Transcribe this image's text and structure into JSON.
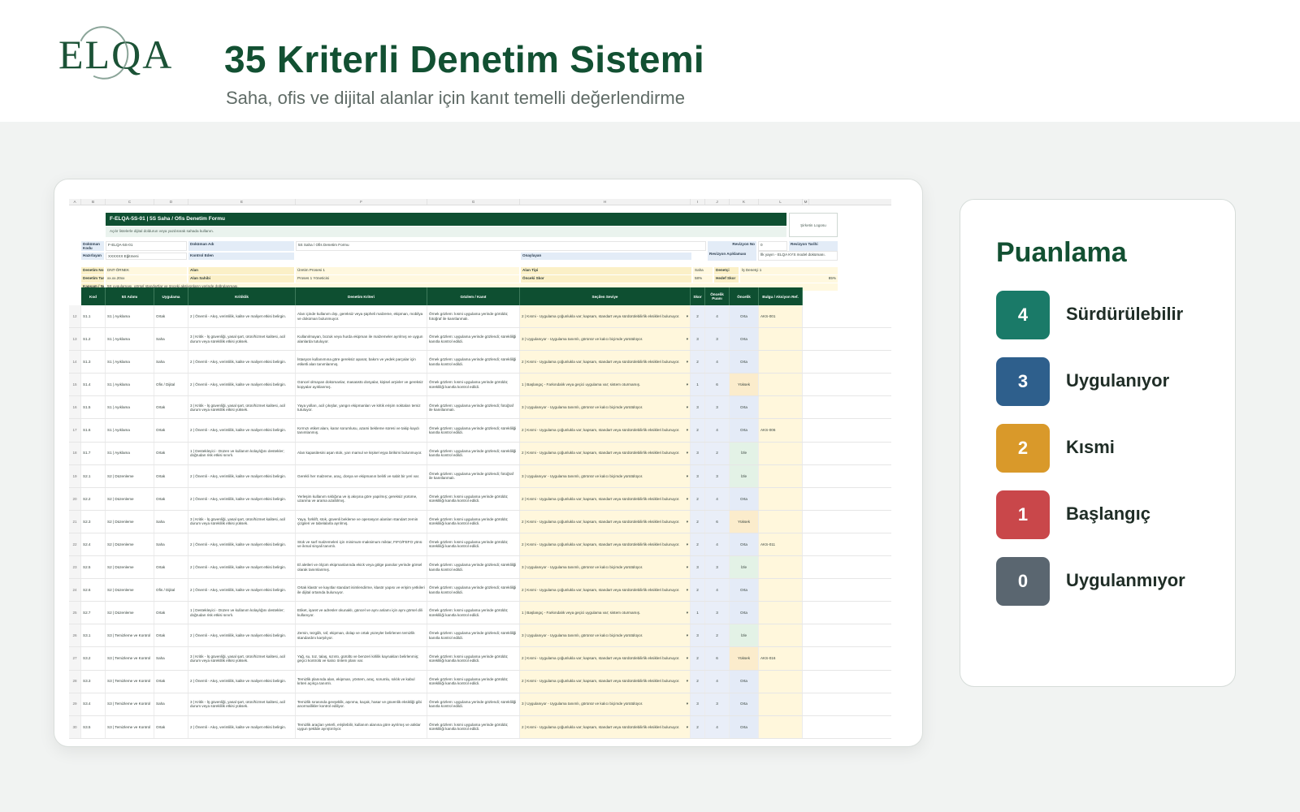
{
  "header": {
    "logo_text": "ELQA",
    "title": "35 Kriterli Denetim Sistemi",
    "subtitle": "Saha, ofis ve dijital alanlar için kanıt temelli değerlendirme"
  },
  "sheet": {
    "column_letters": [
      "A",
      "B",
      "C",
      "D",
      "E",
      "F",
      "G",
      "H",
      "I",
      "J",
      "K",
      "L",
      "M"
    ],
    "form_title": "F-ELQA-5S-01 | 5S Saha / Ofis Denetim Formu",
    "form_subtitle": "Açılır listelerle dijital doldurun veya yazdırarak sahada kullanın.",
    "logo_placeholder": "Şirketin Logosu",
    "meta": {
      "dokuman_kodu_label": "Doküman Kodu",
      "dokuman_kodu": "F-ELQA-5S-01",
      "dokuman_adi_label": "Doküman Adı",
      "dokuman_adi": "5S Saha / Ofis Denetim Formu",
      "revizyon_no_label": "Revizyon No",
      "revizyon_no": "0",
      "revizyon_tarihi_label": "Revizyon Tarihi",
      "hazirlayan_label": "Hazırlayan",
      "hazirlayan": "XXXXXX Eğitmeni",
      "kontrol_eden_label": "Kontrol Eden",
      "onaylayan_label": "Onaylayan",
      "revizyon_aciklamasi_label": "Revizyon Açıklaması",
      "revizyon_aciklamasi": "İlk yayın - ELQA KYS model dokümanı.",
      "denetim_no_label": "Denetim No",
      "denetim_no": "DNT-ÖRNEK",
      "alan_label": "Alan",
      "alan": "Üretim Prosesi 1",
      "alan_tipi_label": "Alan Tipi",
      "alan_tipi": "Saha",
      "denetci_label": "Denetçi",
      "denetci": "İş Denetçi 1",
      "denetim_tarihi_label": "Denetim Tarihi",
      "denetim_tarihi": "xx.xx.20xx",
      "alan_sahibi_label": "Alan Sahibi",
      "alan_sahibi": "Proses 1 Yöneticisi",
      "onceki_skor_label": "Önceki Skor",
      "onceki_skor": "58%",
      "hedef_skor_label": "Hedef Skor",
      "hedef_skor": "85%",
      "kapsam_label": "Kapsam / Not",
      "kapsam": "5S uygulaması, görsel standartlar ve önceki aksiyonların yerinde doğrulanması."
    },
    "columns": [
      "Kod",
      "5S Adımı",
      "Uygulama",
      "Kritiklik",
      "Denetim Kriteri",
      "Gözlem / Kanıt",
      "Seçilen Seviye",
      "Skor",
      "Öncelik Puanı",
      "Öncelik",
      "Bulgu / Aksiyon Ref."
    ],
    "row_numbers": [
      "12",
      "13",
      "14",
      "15",
      "16",
      "17",
      "18",
      "19",
      "20",
      "21",
      "22",
      "23",
      "24",
      "25",
      "26",
      "27",
      "28",
      "29",
      "30"
    ],
    "rows": [
      {
        "rn": "12",
        "kod": "S1.1",
        "adim": "S1 | Ayıklama",
        "uyg": "Ortak",
        "krit": "2 | Önemli - Akış, verimlilik, kalite ve maliyet etkisi belirgin.",
        "kriter": "Alan içinde kullanım dışı, gereksiz veya şüpheli malzeme, ekipman, mobilya ve doküman bulunmuyor.",
        "gozlem": "Örnek gözlem: kısmi uygulama yerinde görüldü; fotoğraf ile kanıtlanmalı.",
        "secim": "2 | Kısmi - Uygulama çoğunlukla var; kapsam, standart veya sürdürülebilirlik eksikleri bulunuyor.",
        "skor": "2",
        "puan": "4",
        "onc": "Orta",
        "lvl": "orta",
        "ref": "AKS-001"
      },
      {
        "rn": "13",
        "kod": "S1.2",
        "adim": "S1 | Ayıklama",
        "uyg": "Saha",
        "krit": "3 | Kritik - İş güvenliği, yasal şart, ürün/hizmet kalitesi, acil durum veya süreklilik etkisi yüksek.",
        "kriter": "Kullanılmayan, bozuk veya hurda ekipman ile malzemeler ayrılmış ve uygun alanlarda tutuluyor.",
        "gozlem": "Örnek gözlem: uygulama yerinde gözlendi; sürekliliği kanıtla kontrol edildi.",
        "secim": "3 | Uygulanıyor - Uygulama tanımlı, görünür ve kalıcı biçimde yürütülüyor.",
        "skor": "3",
        "puan": "3",
        "onc": "Orta",
        "lvl": "orta",
        "ref": ""
      },
      {
        "rn": "14",
        "kod": "S1.3",
        "adim": "S1 | Ayıklama",
        "uyg": "Saha",
        "krit": "2 | Önemli - Akış, verimlilik, kalite ve maliyet etkisi belirgin.",
        "kriter": "İstasyon kullanımına göre gereksiz aparat, bakım ve yedek parçalar için etiketli alan tanımlanmış.",
        "gozlem": "Örnek gözlem: uygulama yerinde gözlendi; sürekliliği kanıtla kontrol edildi.",
        "secim": "2 | Kısmi - Uygulama çoğunlukla var; kapsam, standart veya sürdürülebilirlik eksikleri bulunuyor.",
        "skor": "2",
        "puan": "4",
        "onc": "Orta",
        "lvl": "orta",
        "ref": ""
      },
      {
        "rn": "15",
        "kod": "S1.4",
        "adim": "S1 | Ayıklama",
        "uyg": "Ofis / Dijital",
        "krit": "2 | Önemli - Akış, verimlilik, kalite ve maliyet etkisi belirgin.",
        "kriter": "Güncel olmayan dokümanlar, masaüstü dosyalar, kişisel arşivler ve gereksiz kopyalar ayıklanmış.",
        "gozlem": "Örnek gözlem: kısmi uygulama yerinde görüldü; sürekliliği kanıtla kontrol edildi.",
        "secim": "1 | Başlangıç - Farkındalık veya geçici uygulama var; sistem oturmamış.",
        "skor": "1",
        "puan": "6",
        "onc": "Yüksek",
        "lvl": "yuksek",
        "ref": ""
      },
      {
        "rn": "16",
        "kod": "S1.5",
        "adim": "S1 | Ayıklama",
        "uyg": "Ortak",
        "krit": "3 | Kritik - İş güvenliği, yasal şart, ürün/hizmet kalitesi, acil durum veya süreklilik etkisi yüksek.",
        "kriter": "Yaya yolları, acil çıkışlar, yangın ekipmanları ve kritik erişim noktaları temiz tutuluyor.",
        "gozlem": "Örnek gözlem: uygulama yerinde gözlendi; fotoğraf ile kanıtlanmalı.",
        "secim": "3 | Uygulanıyor - Uygulama tanımlı, görünür ve kalıcı biçimde yürütülüyor.",
        "skor": "3",
        "puan": "3",
        "onc": "Orta",
        "lvl": "orta",
        "ref": ""
      },
      {
        "rn": "17",
        "kod": "S1.6",
        "adim": "S1 | Ayıklama",
        "uyg": "Ortak",
        "krit": "2 | Önemli - Akış, verimlilik, kalite ve maliyet etkisi belirgin.",
        "kriter": "Kırmızı etiket alanı, karar sorumlusu, azami bekleme süresi ve takip kaydı tanımlanmış.",
        "gozlem": "Örnek gözlem: uygulama yerinde gözlendi; sürekliliği kanıtla kontrol edildi.",
        "secim": "2 | Kısmi - Uygulama çoğunlukla var; kapsam, standart veya sürdürülebilirlik eksikleri bulunuyor.",
        "skor": "2",
        "puan": "4",
        "onc": "Orta",
        "lvl": "orta",
        "ref": "AKS-006"
      },
      {
        "rn": "18",
        "kod": "S1.7",
        "adim": "S1 | Ayıklama",
        "uyg": "Ortak",
        "krit": "1 | Destekleyici - Düzen ve kullanım kolaylığını destekler; doğrudan risk etkisi sınırlı.",
        "kriter": "Alan kapasitesini aşan stok, yarı mamul ve kişisel eşya birikimi bulunmuyor.",
        "gozlem": "Örnek gözlem: uygulama yerinde gözlendi; sürekliliği kanıtla kontrol edildi.",
        "secim": "2 | Kısmi - Uygulama çoğunlukla var; kapsam, standart veya sürdürülebilirlik eksikleri bulunuyor.",
        "skor": "3",
        "puan": "2",
        "onc": "İzle",
        "lvl": "iyi",
        "ref": ""
      },
      {
        "rn": "19",
        "kod": "S2.1",
        "adim": "S2 | Düzenleme",
        "uyg": "Ortak",
        "krit": "2 | Önemli - Akış, verimlilik, kalite ve maliyet etkisi belirgin.",
        "kriter": "Gerekli her malzeme, araç, dosya ve ekipmanın belirli ve sabit bir yeri var.",
        "gozlem": "Örnek gözlem: uygulama yerinde gözlendi; fotoğraf ile kanıtlanmalı.",
        "secim": "3 | Uygulanıyor - Uygulama tanımlı, görünür ve kalıcı biçimde yürütülüyor.",
        "skor": "3",
        "puan": "3",
        "onc": "İzle",
        "lvl": "iyi",
        "ref": ""
      },
      {
        "rn": "20",
        "kod": "S2.2",
        "adim": "S2 | Düzenleme",
        "uyg": "Ortak",
        "krit": "2 | Önemli - Akış, verimlilik, kalite ve maliyet etkisi belirgin.",
        "kriter": "Yerleşim kullanım sıklığına ve iş akışına göre yapılmış; gereksiz yürüme, uzanma ve arama azaltılmış.",
        "gozlem": "Örnek gözlem: kısmi uygulama yerinde görüldü; sürekliliği kanıtla kontrol edildi.",
        "secim": "2 | Kısmi - Uygulama çoğunlukla var; kapsam, standart veya sürdürülebilirlik eksikleri bulunuyor.",
        "skor": "2",
        "puan": "4",
        "onc": "Orta",
        "lvl": "orta",
        "ref": ""
      },
      {
        "rn": "21",
        "kod": "S2.3",
        "adim": "S2 | Düzenleme",
        "uyg": "Saha",
        "krit": "3 | Kritik - İş güvenliği, yasal şart, ürün/hizmet kalitesi, acil durum veya süreklilik etkisi yüksek.",
        "kriter": "Yaya, forklift, stok, güvenli bekleme ve operasyon alanları standart zemin çizgileri ve tabelalarla ayrılmış.",
        "gozlem": "Örnek gözlem: kısmi uygulama yerinde görüldü; sürekliliği kanıtla kontrol edildi.",
        "secim": "2 | Kısmi - Uygulama çoğunlukla var; kapsam, standart veya sürdürülebilirlik eksikleri bulunuyor.",
        "skor": "2",
        "puan": "6",
        "onc": "Yüksek",
        "lvl": "yuksek",
        "ref": ""
      },
      {
        "rn": "22",
        "kod": "S2.4",
        "adim": "S2 | Düzenleme",
        "uyg": "Saha",
        "krit": "2 | Önemli - Akış, verimlilik, kalite ve maliyet etkisi belirgin.",
        "kriter": "Stok ve sarf malzemeleri için minimum-maksimum miktar, FIFO/FEFO yönü ve ikmal sinyali tanımlı.",
        "gozlem": "Örnek gözlem: kısmi uygulama yerinde görüldü; sürekliliği kanıtla kontrol edildi.",
        "secim": "2 | Kısmi - Uygulama çoğunlukla var; kapsam, standart veya sürdürülebilirlik eksikleri bulunuyor.",
        "skor": "2",
        "puan": "4",
        "onc": "Orta",
        "lvl": "orta",
        "ref": "AKS-011"
      },
      {
        "rn": "23",
        "kod": "S2.5",
        "adim": "S2 | Düzenleme",
        "uyg": "Ortak",
        "krit": "2 | Önemli - Akış, verimlilik, kalite ve maliyet etkisi belirgin.",
        "kriter": "El aletleri ve ölçüm ekipmanlarında ekick veya gölge panolar yerinde görsel olarak tanımlanmış.",
        "gozlem": "Örnek gözlem: uygulama yerinde gözlendi; sürekliliği kanıtla kontrol edildi.",
        "secim": "3 | Uygulanıyor - Uygulama tanımlı, görünür ve kalıcı biçimde yürütülüyor.",
        "skor": "3",
        "puan": "3",
        "onc": "İzle",
        "lvl": "iyi",
        "ref": ""
      },
      {
        "rn": "24",
        "kod": "S2.6",
        "adim": "S2 | Düzenleme",
        "uyg": "Ofis / Dijital",
        "krit": "2 | Önemli - Akış, verimlilik, kalite ve maliyet etkisi belirgin.",
        "kriter": "Ortak klasör ve kayıtlar standart isimlendirme, klasör yapısı ve erişim yetkileri ile dijital ortamda bulunuyor.",
        "gozlem": "Örnek gözlem: uygulama yerinde gözlendi; sürekliliği kanıtla kontrol edildi.",
        "secim": "2 | Kısmi - Uygulama çoğunlukla var; kapsam, standart veya sürdürülebilirlik eksikleri bulunuyor.",
        "skor": "2",
        "puan": "4",
        "onc": "Orta",
        "lvl": "orta",
        "ref": ""
      },
      {
        "rn": "25",
        "kod": "S2.7",
        "adim": "S2 | Düzenleme",
        "uyg": "Ortak",
        "krit": "1 | Destekleyici - Düzen ve kullanım kolaylığını destekler; doğrudan risk etkisi sınırlı.",
        "kriter": "Etiket, işaret ve adresler okunaklı, güncel ve aynı anlamı için aynı görsel dili kullanıyor.",
        "gozlem": "Örnek gözlem: kısmi uygulama yerinde görüldü; sürekliliği kanıtla kontrol edildi.",
        "secim": "1 | Başlangıç - Farkındalık veya geçici uygulama var; sistem oturmamış.",
        "skor": "1",
        "puan": "3",
        "onc": "Orta",
        "lvl": "orta",
        "ref": ""
      },
      {
        "rn": "26",
        "kod": "S3.1",
        "adim": "S3 | Temizleme ve Kontrol",
        "uyg": "Ortak",
        "krit": "2 | Önemli - Akış, verimlilik, kalite ve maliyet etkisi belirgin.",
        "kriter": "Zemin, tezgâh, raf, ekipman, dolap ve ortak yüzeyler belirlenen temizlik standardını karşılıyor.",
        "gozlem": "Örnek gözlem: uygulama yerinde gözlendi; sürekliliği kanıtla kontrol edildi.",
        "secim": "3 | Uygulanıyor - Uygulama tanımlı, görünür ve kalıcı biçimde yürütülüyor.",
        "skor": "3",
        "puan": "2",
        "onc": "İzle",
        "lvl": "iyi",
        "ref": ""
      },
      {
        "rn": "27",
        "kod": "S3.2",
        "adim": "S3 | Temizleme ve Kontrol",
        "uyg": "Saha",
        "krit": "3 | Kritik - İş güvenliği, yasal şart, ürün/hizmet kalitesi, acil durum veya süreklilik etkisi yüksek.",
        "kriter": "Yağ, su, toz, talaş, sızıntı, gürültü ve benzeri kirlilik kaynakları belirlenmiş; geçici kontrolü ve kalıcı önlem planı var.",
        "gozlem": "Örnek gözlem: kısmi uygulama yerinde görüldü; sürekliliği kanıtla kontrol edildi.",
        "secim": "2 | Kısmi - Uygulama çoğunlukla var; kapsam, standart veya sürdürülebilirlik eksikleri bulunuyor.",
        "skor": "2",
        "puan": "6",
        "onc": "Yüksek",
        "lvl": "yuksek",
        "ref": "AKS-016"
      },
      {
        "rn": "28",
        "kod": "S3.3",
        "adim": "S3 | Temizleme ve Kontrol",
        "uyg": "Ortak",
        "krit": "2 | Önemli - Akış, verimlilik, kalite ve maliyet etkisi belirgin.",
        "kriter": "Temizlik planında alan, ekipman, yöntem, araç, sorumlu, sıklık ve kabul kriteri açıkça tanımlı.",
        "gozlem": "Örnek gözlem: kısmi uygulama yerinde görüldü; sürekliliği kanıtla kontrol edildi.",
        "secim": "2 | Kısmi - Uygulama çoğunlukla var; kapsam, standart veya sürdürülebilirlik eksikleri bulunuyor.",
        "skor": "2",
        "puan": "4",
        "onc": "Orta",
        "lvl": "orta",
        "ref": ""
      },
      {
        "rn": "29",
        "kod": "S3.4",
        "adim": "S3 | Temizleme ve Kontrol",
        "uyg": "Saha",
        "krit": "3 | Kritik - İş güvenliği, yasal şart, ürün/hizmet kalitesi, acil durum veya süreklilik etkisi yüksek.",
        "kriter": "Temizlik sırasında gevşeklik, aşınma, kaçak, hasar ve güvenlik eksikliği gibi anormallikler kontrol ediliyor.",
        "gozlem": "Örnek gözlem: uygulama yerinde gözlendi; sürekliliği kanıtla kontrol edildi.",
        "secim": "3 | Uygulanıyor - Uygulama tanımlı, görünür ve kalıcı biçimde yürütülüyor.",
        "skor": "3",
        "puan": "3",
        "onc": "Orta",
        "lvl": "orta",
        "ref": ""
      },
      {
        "rn": "30",
        "kod": "S3.5",
        "adim": "S3 | Temizleme ve Kontrol",
        "uyg": "Ortak",
        "krit": "2 | Önemli - Akış, verimlilik, kalite ve maliyet etkisi belirgin.",
        "kriter": "Temizlik araçları yeterli, erişilebilir, kullanım alanına göre ayrılmış ve atıklar uygun şekilde ayrıştırılıyor.",
        "gozlem": "Örnek gözlem: kısmi uygulama yerinde görüldü; sürekliliği kanıtla kontrol edildi.",
        "secim": "2 | Kısmi - Uygulama çoğunlukla var; kapsam, standart veya sürdürülebilirlik eksikleri bulunuyor.",
        "skor": "2",
        "puan": "4",
        "onc": "Orta",
        "lvl": "orta",
        "ref": ""
      }
    ]
  },
  "scoring": {
    "title": "Puanlama",
    "items": [
      {
        "score": "4",
        "label": "Sürdürülebilir",
        "color": "#1a7a68"
      },
      {
        "score": "3",
        "label": "Uygulanıyor",
        "color": "#2e5f8c"
      },
      {
        "score": "2",
        "label": "Kısmi",
        "color": "#d9992a"
      },
      {
        "score": "1",
        "label": "Başlangıç",
        "color": "#c9474a"
      },
      {
        "score": "0",
        "label": "Uygulanmıyor",
        "color": "#5a6670"
      }
    ]
  }
}
